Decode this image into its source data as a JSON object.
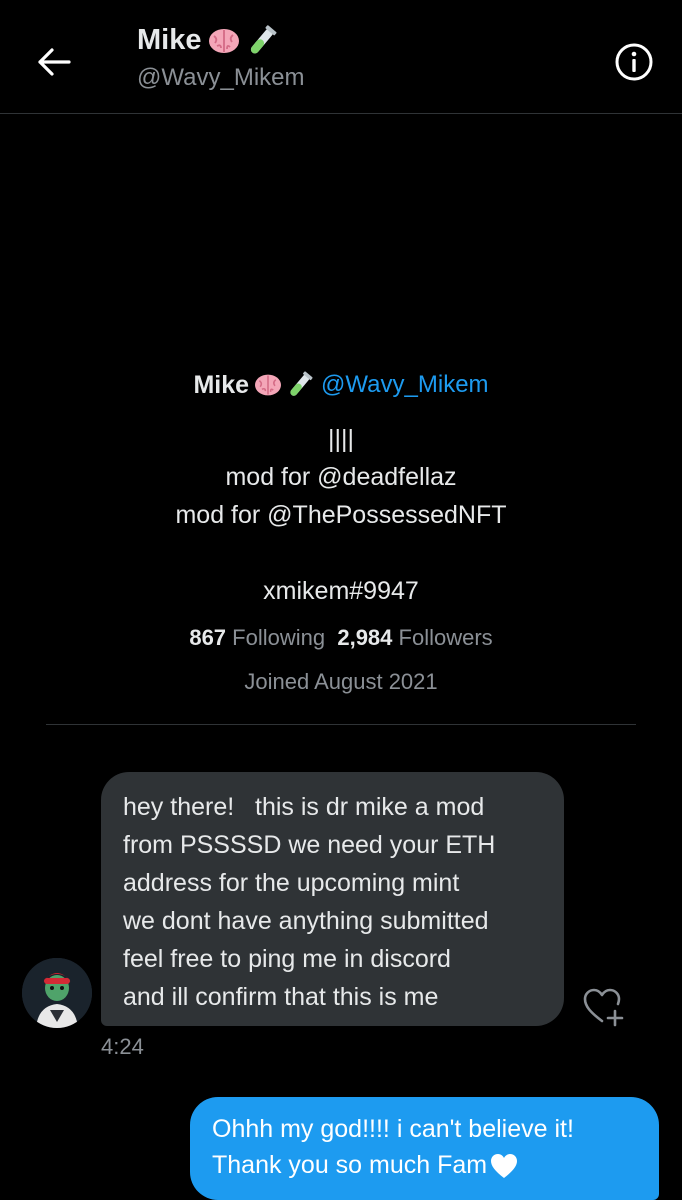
{
  "header": {
    "name": "Mike",
    "name_emojis": [
      "brain-emoji",
      "test-tube-emoji"
    ],
    "handle": "@Wavy_Mikem"
  },
  "profile": {
    "name": "Mike",
    "handle": "@Wavy_Mikem",
    "bio_lines": [
      "||||",
      "mod for @deadfellaz",
      "mod for @ThePossessedNFT",
      "",
      "xmikem#9947"
    ],
    "following_count": "867",
    "following_label": "Following",
    "followers_count": "2,984",
    "followers_label": "Followers",
    "joined": "Joined August 2021"
  },
  "messages": [
    {
      "direction": "incoming",
      "lines": [
        "hey there!   this is dr mike a mod",
        "from PSSSSD we need your ETH",
        "address for the upcoming mint",
        "we dont have anything submitted",
        "feel free to ping me in discord",
        "and ill confirm that this is me"
      ],
      "time": "4:24"
    },
    {
      "direction": "outgoing",
      "lines": [
        "Ohhh my god!!!! i can't believe it!",
        "Thank you so much Fam"
      ],
      "trailing_emoji": "white-heart-emoji"
    }
  ],
  "colors": {
    "background": "#000000",
    "accent": "#1d9bf0",
    "incoming_bubble": "#2f3336",
    "secondary_text": "#8b9096"
  }
}
